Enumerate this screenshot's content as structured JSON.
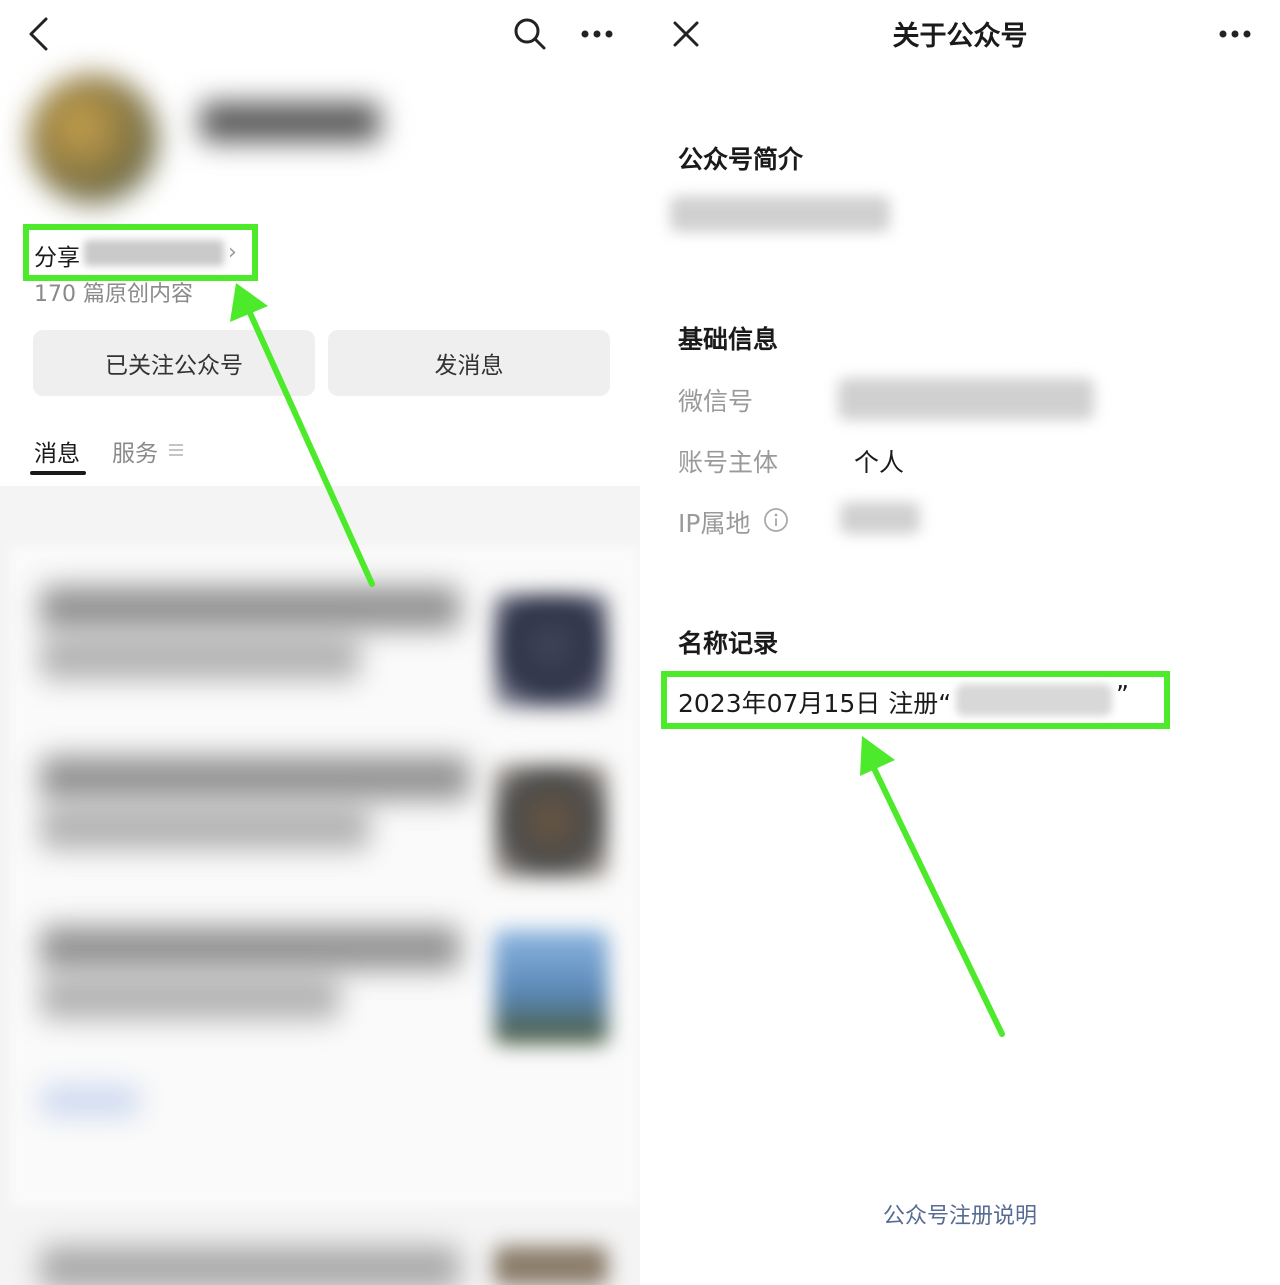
{
  "left": {
    "profile": {
      "share_prefix": "分享",
      "articles": "170 篇原创内容"
    },
    "buttons": {
      "followed": "已关注公众号",
      "message": "发消息"
    },
    "tabs": {
      "messages": "消息",
      "services": "服务"
    }
  },
  "right": {
    "title": "关于公众号",
    "intro_heading": "公众号简介",
    "basic_heading": "基础信息",
    "rows": {
      "wechat_id_label": "微信号",
      "entity_label": "账号主体",
      "entity_value": "个人",
      "ip_label": "IP属地"
    },
    "name_record_heading": "名称记录",
    "record_text": "2023年07月15日 注册“",
    "record_close_quote": "”",
    "footer_link": "公众号注册说明"
  },
  "colors": {
    "highlight": "#4cea2a",
    "link": "#576b95",
    "button_bg": "#efefef"
  },
  "icons": {
    "back": "chevron-left-icon",
    "search": "search-icon",
    "more": "more-horizontal-icon",
    "close": "close-icon",
    "info": "info-circle-icon",
    "menu": "menu-lines-icon"
  }
}
